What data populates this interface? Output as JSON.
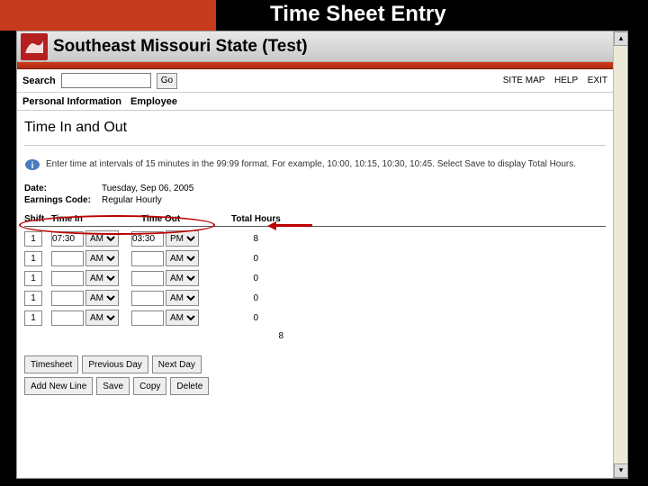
{
  "slide_title": "Time Sheet Entry",
  "site_title": "Southeast Missouri State (Test)",
  "search_label": "Search",
  "go_label": "Go",
  "toplinks": {
    "sitemap": "SITE MAP",
    "help": "HELP",
    "exit": "EXIT"
  },
  "nav": {
    "personal": "Personal Information",
    "employee": "Employee"
  },
  "page_heading": "Time In and Out",
  "info_text": "Enter time at intervals of 15 minutes in the 99:99 format. For example, 10:00, 10:15, 10:30, 10:45. Select Save to display Total Hours.",
  "meta": {
    "date_label": "Date:",
    "date_value": "Tuesday, Sep 06, 2005",
    "earn_label": "Earnings Code:",
    "earn_value": "Regular Hourly"
  },
  "grid_headers": {
    "shift": "Shift",
    "tin": "Time In",
    "tout": "Time Out",
    "total": "Total Hours"
  },
  "rows": [
    {
      "shift": "1",
      "in": "07:30",
      "in_ampm": "AM",
      "out": "03:30",
      "out_ampm": "PM",
      "total": "8"
    },
    {
      "shift": "1",
      "in": "",
      "in_ampm": "AM",
      "out": "",
      "out_ampm": "AM",
      "total": "0"
    },
    {
      "shift": "1",
      "in": "",
      "in_ampm": "AM",
      "out": "",
      "out_ampm": "AM",
      "total": "0"
    },
    {
      "shift": "1",
      "in": "",
      "in_ampm": "AM",
      "out": "",
      "out_ampm": "AM",
      "total": "0"
    },
    {
      "shift": "1",
      "in": "",
      "in_ampm": "AM",
      "out": "",
      "out_ampm": "AM",
      "total": "0"
    }
  ],
  "grand_total": "8",
  "buttons": {
    "timesheet": "Timesheet",
    "prev": "Previous Day",
    "next": "Next Day",
    "addline": "Add New Line",
    "save": "Save",
    "copy": "Copy",
    "delete": "Delete"
  },
  "ampm_options": [
    "AM",
    "PM"
  ]
}
